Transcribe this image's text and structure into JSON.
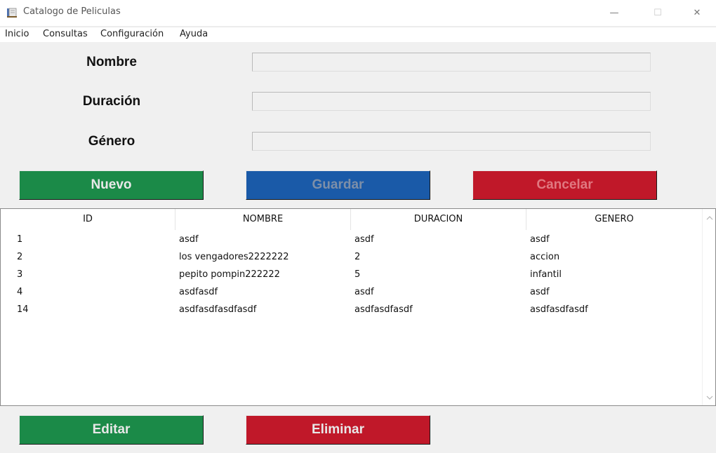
{
  "window": {
    "title": "Catalogo de Peliculas",
    "controls": {
      "minimize": "—",
      "maximize": "☐",
      "close": "✕"
    }
  },
  "menu": {
    "items": [
      {
        "label": "Inicio"
      },
      {
        "label": "Consultas"
      },
      {
        "label": "Configuración"
      },
      {
        "label": "Ayuda"
      }
    ]
  },
  "form": {
    "nombre": {
      "label": "Nombre",
      "value": ""
    },
    "duracion": {
      "label": "Duración",
      "value": ""
    },
    "genero": {
      "label": "Género",
      "value": ""
    }
  },
  "buttons": {
    "nuevo": "Nuevo",
    "guardar": "Guardar",
    "cancelar": "Cancelar",
    "editar": "Editar",
    "eliminar": "Eliminar"
  },
  "table": {
    "columns": [
      "ID",
      "NOMBRE",
      "DURACION",
      "GENERO"
    ],
    "rows": [
      [
        "1",
        "asdf",
        "asdf",
        "asdf"
      ],
      [
        "2",
        "los vengadores2222222",
        "2",
        "accion"
      ],
      [
        "3",
        "pepito pompin222222",
        "5",
        "infantil"
      ],
      [
        "4",
        "asdfasdf",
        "asdf",
        "asdf"
      ],
      [
        "14",
        "asdfasdfasdfasdf",
        "asdfasdfasdf",
        "asdfasdfasdf"
      ]
    ]
  },
  "colors": {
    "green": "#1b8a48",
    "blue": "#1a5aa8",
    "red": "#c01829"
  }
}
